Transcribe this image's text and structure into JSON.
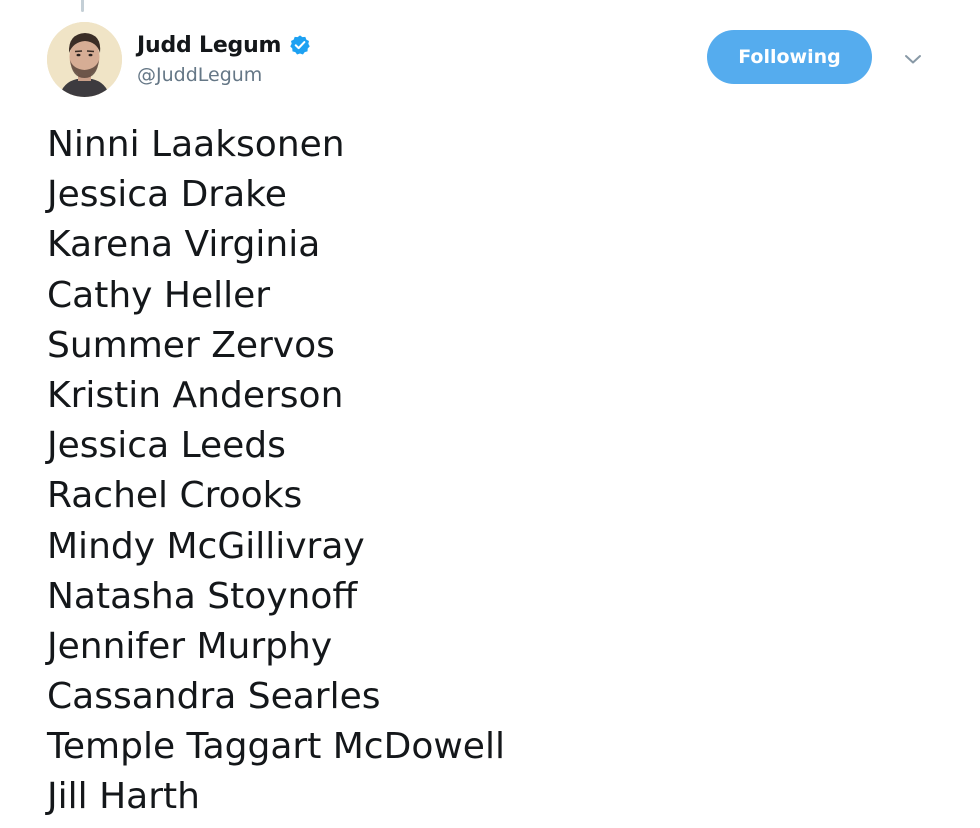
{
  "tweet": {
    "author": {
      "display_name": "Judd Legum",
      "handle": "@JuddLegum",
      "verified": true,
      "verified_icon": "verified-badge-icon",
      "avatar": "avatar"
    },
    "follow_button": {
      "label": "Following"
    },
    "menu_icon": "chevron-down-icon",
    "lines": [
      "Ninni Laaksonen",
      "Jessica Drake",
      "Karena Virginia",
      "Cathy Heller",
      "Summer Zervos",
      "Kristin Anderson",
      "Jessica Leeds",
      "Rachel Crooks",
      "Mindy McGillivray",
      "Natasha Stoynoff",
      "Jennifer Murphy",
      "Cassandra Searles",
      "Temple Taggart McDowell",
      "Jill Harth"
    ]
  },
  "colors": {
    "accent": "#55acee",
    "verified": "#1da1f2",
    "text": "#14171a",
    "secondary_text": "#657786"
  }
}
